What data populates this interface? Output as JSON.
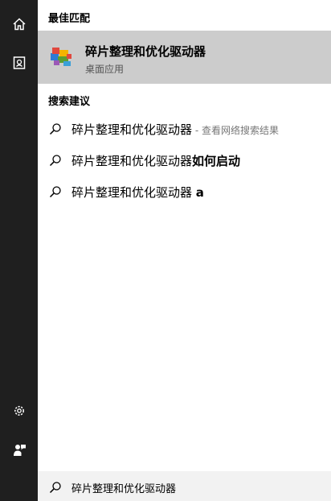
{
  "sidebar": {
    "items": [
      {
        "icon": "home-icon"
      },
      {
        "icon": "notebook-icon"
      },
      {
        "icon": "gear-icon"
      },
      {
        "icon": "feedback-icon"
      }
    ]
  },
  "best_match": {
    "heading": "最佳匹配",
    "app_name": "碎片整理和优化驱动器",
    "app_type": "桌面应用",
    "icon": "defrag-app-icon"
  },
  "suggestions": {
    "heading": "搜索建议",
    "items": [
      {
        "text": "碎片整理和优化驱动器",
        "suffix": " - 查看网络搜索结果"
      },
      {
        "text": "碎片整理和优化驱动器",
        "suffix": "如何启动"
      },
      {
        "text": "碎片整理和优化驱动器 ",
        "suffix": "a"
      }
    ]
  },
  "search": {
    "query": "碎片整理和优化驱动器",
    "icon": "search-icon"
  },
  "colors": {
    "sidebar_bg": "#1f1f1f",
    "highlight_bg": "#cccccc",
    "search_bg": "#f2f2f2"
  }
}
